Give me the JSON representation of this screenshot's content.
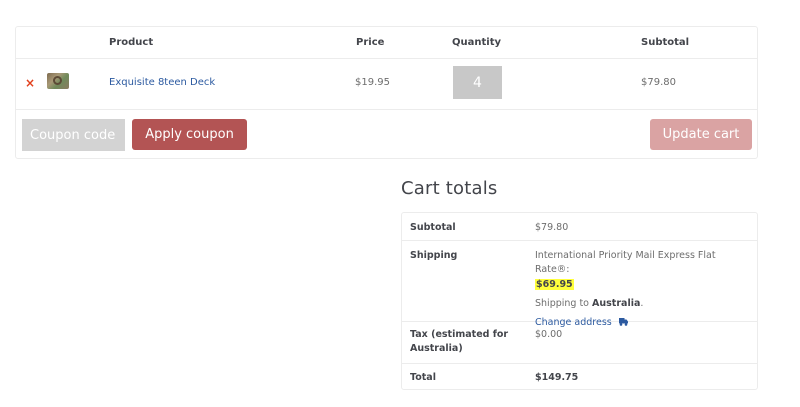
{
  "cart": {
    "headers": {
      "product": "Product",
      "price": "Price",
      "quantity": "Quantity",
      "subtotal": "Subtotal"
    },
    "items": [
      {
        "product": "Exquisite 8teen Deck",
        "price": "$19.95",
        "quantity": "4",
        "subtotal": "$79.80"
      }
    ],
    "remove_symbol": "×"
  },
  "actions": {
    "coupon_placeholder": "Coupon code",
    "apply_label": "Apply coupon",
    "update_label": "Update cart"
  },
  "totals": {
    "title": "Cart totals",
    "subtotal_label": "Subtotal",
    "subtotal_value": "$79.80",
    "shipping_label": "Shipping",
    "shipping_method": "International Priority Mail Express Flat Rate®:",
    "shipping_price": "$69.95",
    "shipping_to_prefix": "Shipping to ",
    "shipping_country": "Australia",
    "shipping_to_suffix": ".",
    "change_address": "Change address",
    "tax_label": "Tax (estimated for Australia)",
    "tax_value": "$0.00",
    "total_label": "Total",
    "total_value": "$149.75"
  },
  "icons": {
    "remove": "remove-icon",
    "shipping": "truck-icon"
  },
  "colors": {
    "link": "#2c5aa0",
    "remove": "#e2401c",
    "apply_button": "#b35454",
    "update_button": "#daa3a3",
    "highlight": "#ffff3c"
  }
}
